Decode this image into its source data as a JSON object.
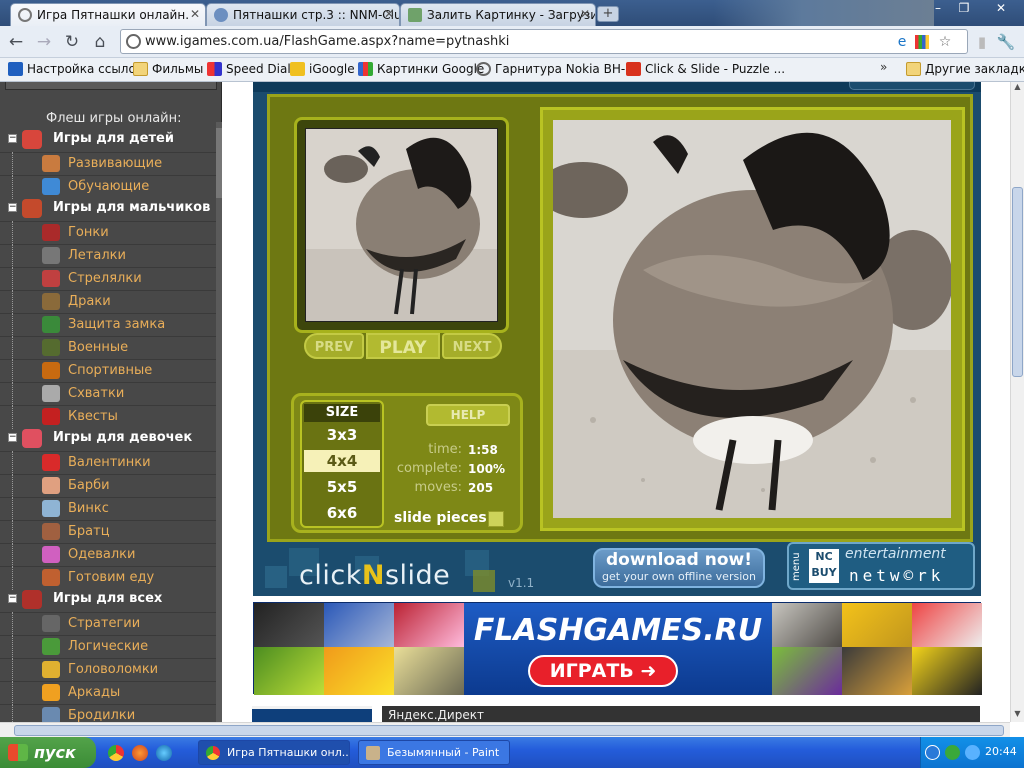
{
  "tabs": [
    {
      "title": "Игра Пятнашки онлайн.",
      "active": true
    },
    {
      "title": "Пятнашки стр.3 :: NNM-Club",
      "active": false
    },
    {
      "title": "Залить Картинку - Загрузить",
      "active": false
    }
  ],
  "window_controls": {
    "minimize": "–",
    "maximize": "❐",
    "close": "✕"
  },
  "toolbar": {
    "url": "www.igames.com.ua/FlashGame.aspx?name=pytnashki",
    "icons": [
      "back-icon",
      "forward-icon",
      "reload-icon",
      "home-icon",
      "star-icon",
      "wrench-icon"
    ]
  },
  "bookmarks": [
    "Настройка ссылок",
    "Фильмы",
    "Speed Dial",
    "iGoogle",
    "Картинки Google",
    "Гарнитура Nokia BH-...",
    "Click & Slide - Puzzle ..."
  ],
  "bookmarks_more": "»",
  "bookmarks_other": "Другие закладки",
  "sidebar": {
    "title": "Флеш игры онлайн:",
    "categories": [
      {
        "label": "Игры для детей",
        "items": [
          "Развивающие",
          "Обучающие"
        ]
      },
      {
        "label": "Игры для мальчиков",
        "items": [
          "Гонки",
          "Леталки",
          "Стрелялки",
          "Драки",
          "Защита замка",
          "Военные",
          "Спортивные",
          "Схватки",
          "Квесты"
        ]
      },
      {
        "label": "Игры для девочек",
        "items": [
          "Валентинки",
          "Барби",
          "Винкс",
          "Братц",
          "Одевалки",
          "Готовим еду"
        ]
      },
      {
        "label": "Игры для всех",
        "items": [
          "Стратегии",
          "Логические",
          "Головоломки",
          "Аркады",
          "Бродилки"
        ]
      }
    ]
  },
  "game": {
    "prev": "PREV",
    "play": "PLAY",
    "next": "NEXT",
    "size_heading": "SIZE",
    "sizes": [
      "3x3",
      "4x4",
      "5x5",
      "6x6"
    ],
    "selected_size": "4x4",
    "help": "HELP",
    "time_label": "time:",
    "time_value": "1:58",
    "complete_label": "complete:",
    "complete_value": "100%",
    "moves_label": "moves:",
    "moves_value": "205",
    "slide_pieces": "slide pieces",
    "logo_pre": "click",
    "logo_n": "N",
    "logo_post": "slide",
    "version": "v1.1",
    "download_title": "download now!",
    "download_sub": "get your own offline version",
    "menu": "menu",
    "nc_line1": "NC",
    "nc_line2": "BUY",
    "entertainment": "entertainment",
    "network": "netw©rk"
  },
  "banner": {
    "title": "FLASHGAMES.RU",
    "button": "ИГРАТЬ ➜"
  },
  "yandex": "Яндекс.Директ",
  "taskbar": {
    "start": "пуск",
    "tasks": [
      "Игра Пятнашки онл...",
      "Безымянный - Paint"
    ],
    "clock": "20:44"
  },
  "colors": {
    "sidebar_link": "#e9ae59",
    "board": "#6e7812",
    "frame": "#1b4c6e"
  }
}
